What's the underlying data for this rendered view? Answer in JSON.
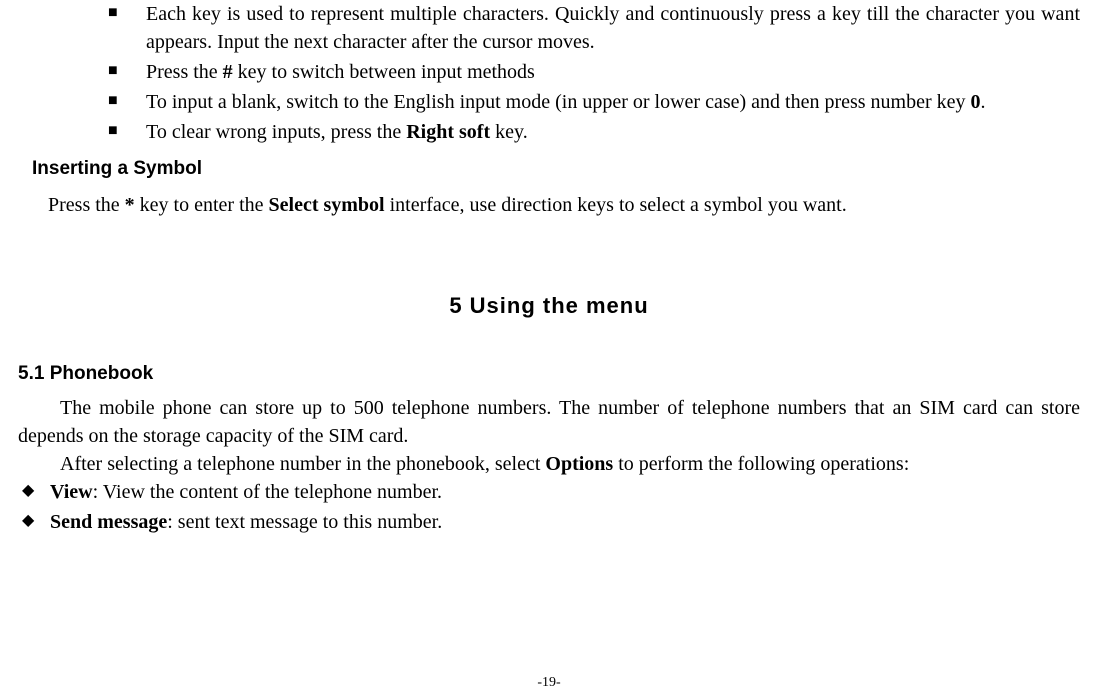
{
  "bullets_top": {
    "b1": "Each key is used to represent multiple characters. Quickly and continuously press a key till the character you want appears. Input the next character after the cursor moves.",
    "b2_pre": "Press the ",
    "b2_hash": "#",
    "b2_post": " key to switch between input methods",
    "b3_pre": "To input a blank, switch to the English input mode (in upper or lower case) and then press number key ",
    "b3_zero": "0",
    "b3_post": ".",
    "b4_pre": "To clear wrong inputs, press the ",
    "b4_rs": "Right soft",
    "b4_post": " key."
  },
  "h_insert": "Inserting a Symbol",
  "press_symbol": {
    "pre": "Press the ",
    "star": "*",
    "mid": " key to enter the ",
    "sel": "Select symbol",
    "post": " interface, use direction keys to select a symbol you want."
  },
  "chapter_title": "5  Using the menu",
  "sec51": "5.1    Phonebook",
  "para1": "The mobile phone can store up to 500 telephone numbers. The number of telephone numbers that an SIM card can store depends on the storage capacity of the SIM card.",
  "para2_pre": "After selecting a telephone number in the phonebook, select ",
  "para2_opts": "Options",
  "para2_post": " to perform the following operations:",
  "d1_label": "View",
  "d1_text": ": View the content of the telephone number.",
  "d2_label": "Send message",
  "d2_text": ": sent text message to this number.",
  "page_num": "-19-"
}
